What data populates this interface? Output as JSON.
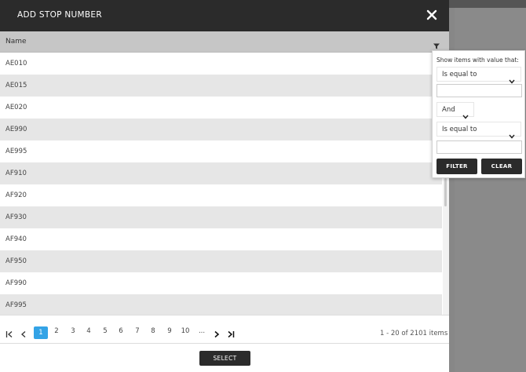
{
  "dialog": {
    "title": "ADD STOP NUMBER"
  },
  "grid": {
    "column_header": "Name",
    "rows": [
      "AE010",
      "AE015",
      "AE020",
      "AE990",
      "AE995",
      "AF910",
      "AF920",
      "AF930",
      "AF940",
      "AF950",
      "AF990",
      "AF995"
    ]
  },
  "pager": {
    "pages": [
      "1",
      "2",
      "3",
      "4",
      "5",
      "6",
      "7",
      "8",
      "9",
      "10",
      "..."
    ],
    "current_page": "1",
    "info": "1 - 20 of 2101 items"
  },
  "footer": {
    "select_label": "SELECT"
  },
  "filter": {
    "help_text": "Show items with value that:",
    "operator1": "Is equal to",
    "value1": "",
    "logic": "And",
    "operator2": "Is equal to",
    "value2": "",
    "filter_label": "FILTER",
    "clear_label": "CLEAR"
  },
  "colors": {
    "header_bg": "#2b2b2b",
    "active_page": "#33a3e6",
    "row_alt": "#e6e6e6"
  }
}
